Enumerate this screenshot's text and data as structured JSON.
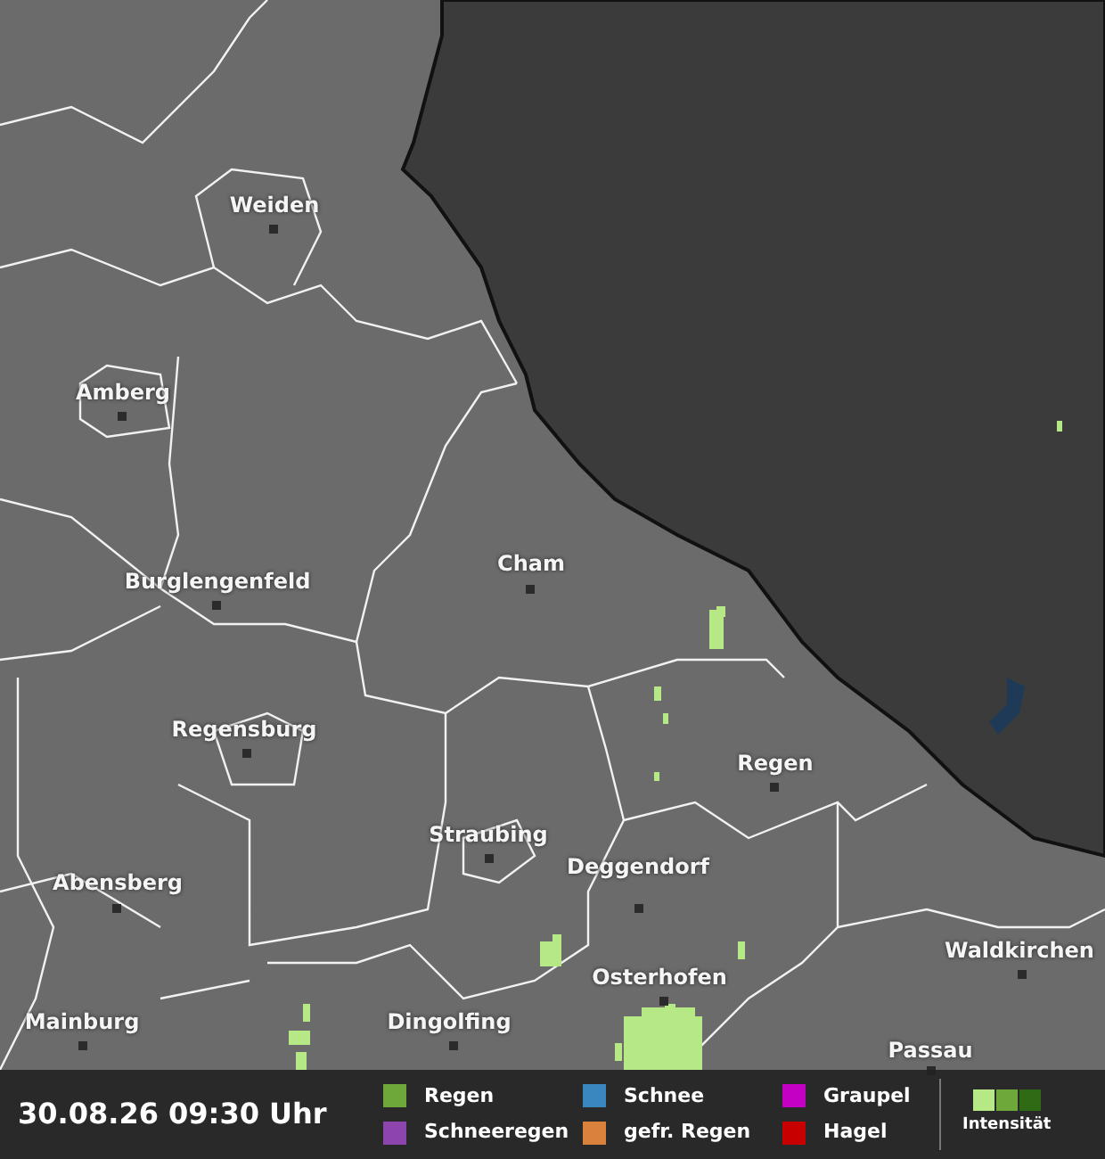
{
  "map": {
    "cities": [
      {
        "name": "Weiden"
      },
      {
        "name": "Amberg"
      },
      {
        "name": "Cham"
      },
      {
        "name": "Burglengenfeld"
      },
      {
        "name": "Regensburg"
      },
      {
        "name": "Regen"
      },
      {
        "name": "Straubing"
      },
      {
        "name": "Deggendorf"
      },
      {
        "name": "Abensberg"
      },
      {
        "name": "Waldkirchen"
      },
      {
        "name": "Osterhofen"
      },
      {
        "name": "Mainburg"
      },
      {
        "name": "Dingolfing"
      },
      {
        "name": "Passau"
      }
    ]
  },
  "legend": {
    "timestamp": "30.08.26 09:30 Uhr",
    "items": [
      {
        "label": "Regen",
        "color": "#6fa83a"
      },
      {
        "label": "Schneeregen",
        "color": "#8e44ad"
      },
      {
        "label": "Schnee",
        "color": "#3a87c0"
      },
      {
        "label": "gefr. Regen",
        "color": "#d9823b"
      },
      {
        "label": "Graupel",
        "color": "#c400c4"
      },
      {
        "label": "Hagel",
        "color": "#c80000"
      }
    ],
    "intensity": {
      "label": "Intensität"
    }
  }
}
